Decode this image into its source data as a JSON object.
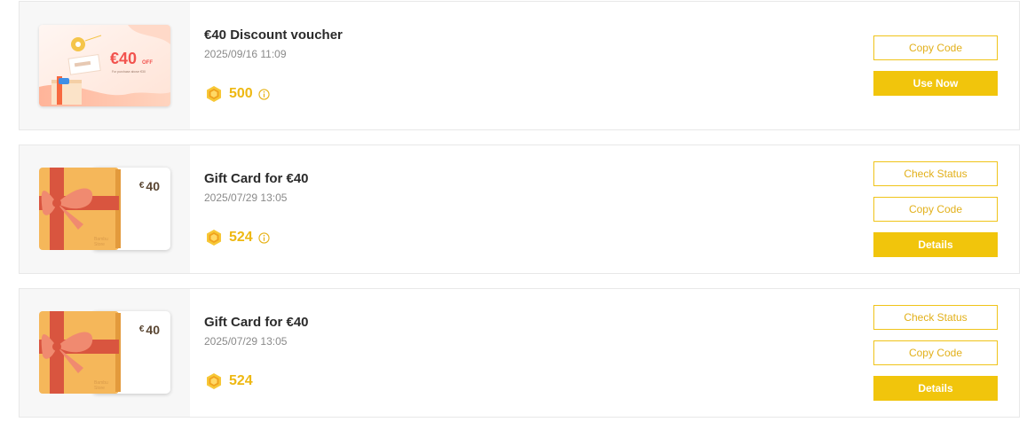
{
  "items": [
    {
      "kind": "voucher",
      "title": "€40 Discount voucher",
      "date": "2025/09/16 11:09",
      "points": "500",
      "show_info_icon": true,
      "thumb": {
        "amount_text": "€40",
        "off_text": "OFF",
        "small_text": "For purchase above €30"
      },
      "buttons": [
        {
          "label": "Copy Code",
          "style": "outline"
        },
        {
          "label": "Use Now",
          "style": "solid"
        }
      ]
    },
    {
      "kind": "gift-card",
      "title": "Gift Card for €40",
      "date": "2025/07/29 13:05",
      "points": "524",
      "show_info_icon": true,
      "thumb": {
        "currency": "€",
        "amount": "40",
        "brand": "Bambu Store"
      },
      "buttons": [
        {
          "label": "Check Status",
          "style": "outline"
        },
        {
          "label": "Copy Code",
          "style": "outline"
        },
        {
          "label": "Details",
          "style": "solid"
        }
      ]
    },
    {
      "kind": "gift-card",
      "title": "Gift Card for €40",
      "date": "2025/07/29 13:05",
      "points": "524",
      "show_info_icon": false,
      "thumb": {
        "currency": "€",
        "amount": "40",
        "brand": "Bambu Store"
      },
      "buttons": [
        {
          "label": "Check Status",
          "style": "outline"
        },
        {
          "label": "Copy Code",
          "style": "outline"
        },
        {
          "label": "Details",
          "style": "solid"
        }
      ]
    }
  ],
  "colors": {
    "accent": "#f1c50c",
    "points": "#eeb812",
    "gift_box": "#f5b75a",
    "ribbon": "#d9553f",
    "bow": "#f08a70",
    "voucher_red": "#f2534e"
  },
  "icons": {
    "coin": "hexagon-coin-icon",
    "info": "info-circle-icon",
    "bow": "gift-bow-icon"
  }
}
